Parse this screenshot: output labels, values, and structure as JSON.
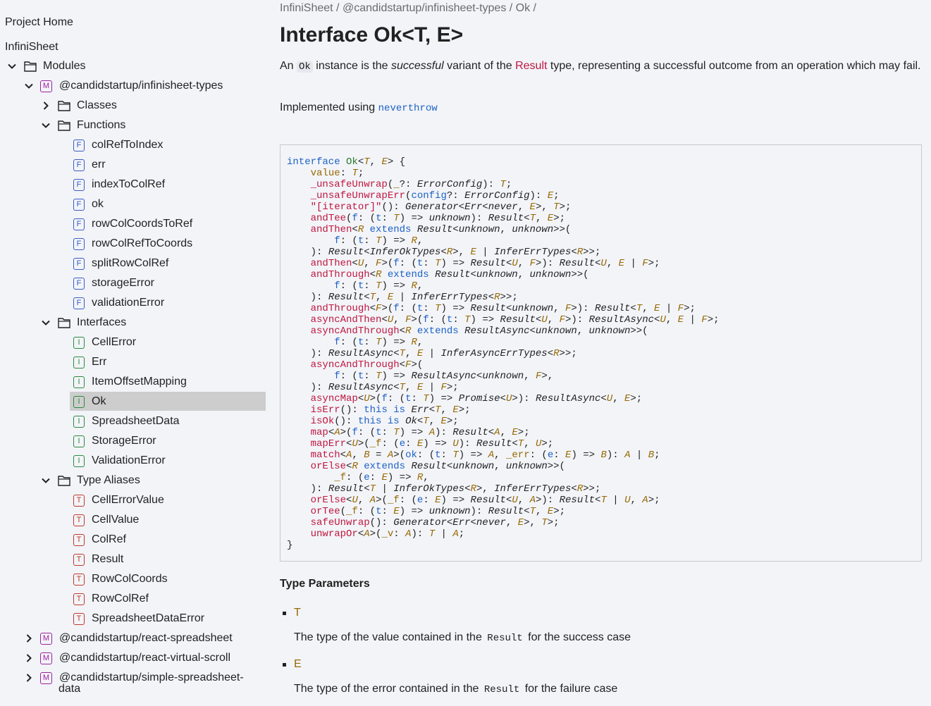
{
  "sidebar": {
    "project_home": "Project Home",
    "project_name": "InfiniSheet",
    "modules_label": "Modules",
    "tree": {
      "types_module": "@candidstartup/infinisheet-types",
      "classes": "Classes",
      "functions": "Functions",
      "function_items": [
        "colRefToIndex",
        "err",
        "indexToColRef",
        "ok",
        "rowColCoordsToRef",
        "rowColRefToCoords",
        "splitRowColRef",
        "storageError",
        "validationError"
      ],
      "interfaces": "Interfaces",
      "interface_items": [
        "CellError",
        "Err",
        "ItemOffsetMapping",
        "Ok",
        "SpreadsheetData",
        "StorageError",
        "ValidationError"
      ],
      "type_aliases": "Type Aliases",
      "type_alias_items": [
        "CellErrorValue",
        "CellValue",
        "ColRef",
        "Result",
        "RowColCoords",
        "RowColRef",
        "SpreadsheetDataError"
      ],
      "other_modules": [
        "@candidstartup/react-spreadsheet",
        "@candidstartup/react-virtual-scroll",
        "@candidstartup/simple-spreadsheet-"
      ],
      "other_modules_line2": "data",
      "kind_letters": {
        "module": "M",
        "function": "F",
        "interface": "I",
        "type_alias": "T"
      }
    }
  },
  "main": {
    "breadcrumb": "InfiniSheet / @candidstartup/infinisheet-types / Ok /",
    "title": "Interface Ok<T, E>",
    "desc_a": "An ",
    "desc_code": "Ok",
    "desc_b": " instance is the ",
    "desc_em": "successful",
    "desc_c": " variant of the ",
    "desc_link": "Result",
    "desc_d": " type, representing a successful outcome from an operation which may fail.",
    "impl_text": "Implemented using ",
    "impl_link": "neverthrow",
    "type_params_heading": "Type Parameters",
    "params": [
      {
        "name": "T",
        "desc_a": "The type of the value contained in the ",
        "desc_code": "Result",
        "desc_b": " for the success case"
      },
      {
        "name": "E",
        "desc_a": "The type of the error contained in the ",
        "desc_code": "Result",
        "desc_b": " for the failure case"
      }
    ]
  },
  "colors": {
    "keyword": "#1d61c5",
    "type_param": "#986801",
    "member": "#c0163f",
    "selected_bg": "#cdcdcd",
    "module_icon": "#a020a0",
    "function_icon": "#3a5bc7",
    "interface_icon": "#2a8a3e",
    "type_icon": "#c0392b"
  }
}
